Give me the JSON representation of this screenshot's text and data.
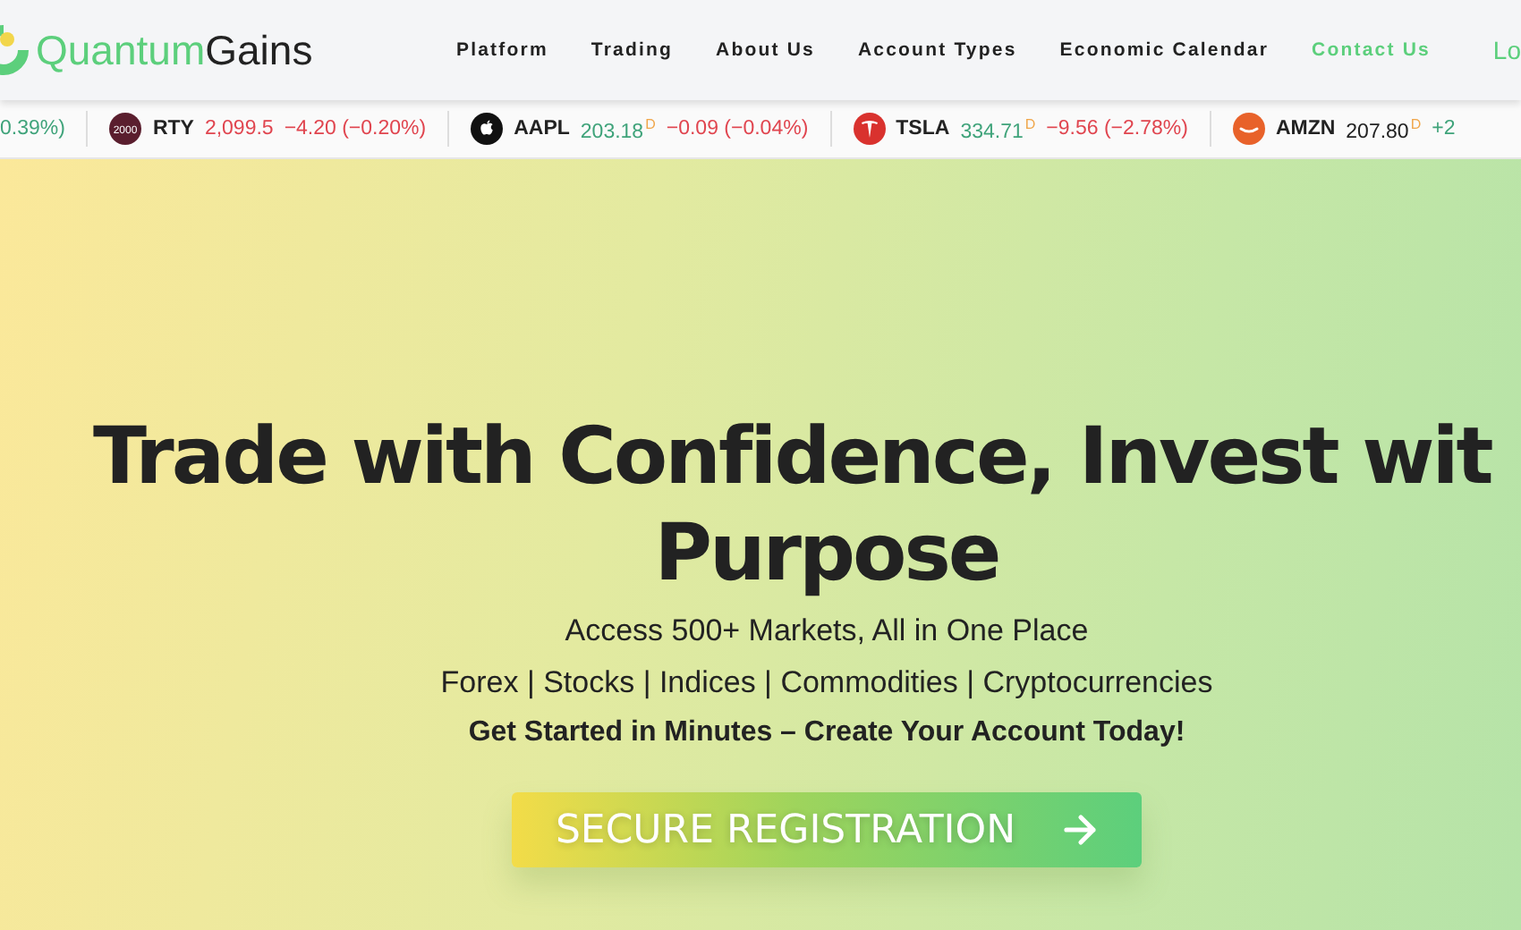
{
  "logo": {
    "first": "Quantum",
    "second": "Gains"
  },
  "nav": [
    {
      "label": "Platform",
      "selected": false
    },
    {
      "label": "Trading",
      "selected": false
    },
    {
      "label": "About Us",
      "selected": false
    },
    {
      "label": "Account Types",
      "selected": false
    },
    {
      "label": "Economic Calendar",
      "selected": false
    },
    {
      "label": "Contact Us",
      "selected": true
    }
  ],
  "login": "Lo",
  "ticker": [
    {
      "kind": "tail",
      "change": {
        "text": "0.39%)",
        "color": "#3fa37a"
      }
    },
    {
      "kind": "badge",
      "badge": "2000",
      "symbol": "RTY",
      "price": "2,099.5",
      "color": "#e0454f",
      "change": {
        "text": "−4.20 (−0.20%)",
        "color": "#e0454f"
      }
    },
    {
      "kind": "fruit",
      "symbol": "AAPL",
      "price": "203.18",
      "color": "#3fa37a",
      "note": "D",
      "change": {
        "text": "−0.09 (−0.04%)",
        "color": "#e0454f"
      }
    },
    {
      "kind": "letter",
      "symbol": "TSLA",
      "price": "334.71",
      "color": "#3fa37a",
      "note": "D",
      "change": {
        "text": "−9.56 (−2.78%)",
        "color": "#e0454f"
      }
    },
    {
      "kind": "smile",
      "symbol": "AMZN",
      "price": "207.80",
      "color": "#222222",
      "note": "D",
      "change": {
        "text": "+2",
        "color": "#3fa37a"
      }
    }
  ],
  "hero": {
    "headline": [
      "Trade with Confidence, Invest wit",
      "Purpose"
    ],
    "subtitle": "Access 500+ Markets, All in One Place",
    "markets": "Forex | Stocks | Indices | Commodities | Cryptocurrencies",
    "cta_text": "Get Started in Minutes – Create Your Account Today!",
    "button": "SECURE REGISTRATION"
  }
}
